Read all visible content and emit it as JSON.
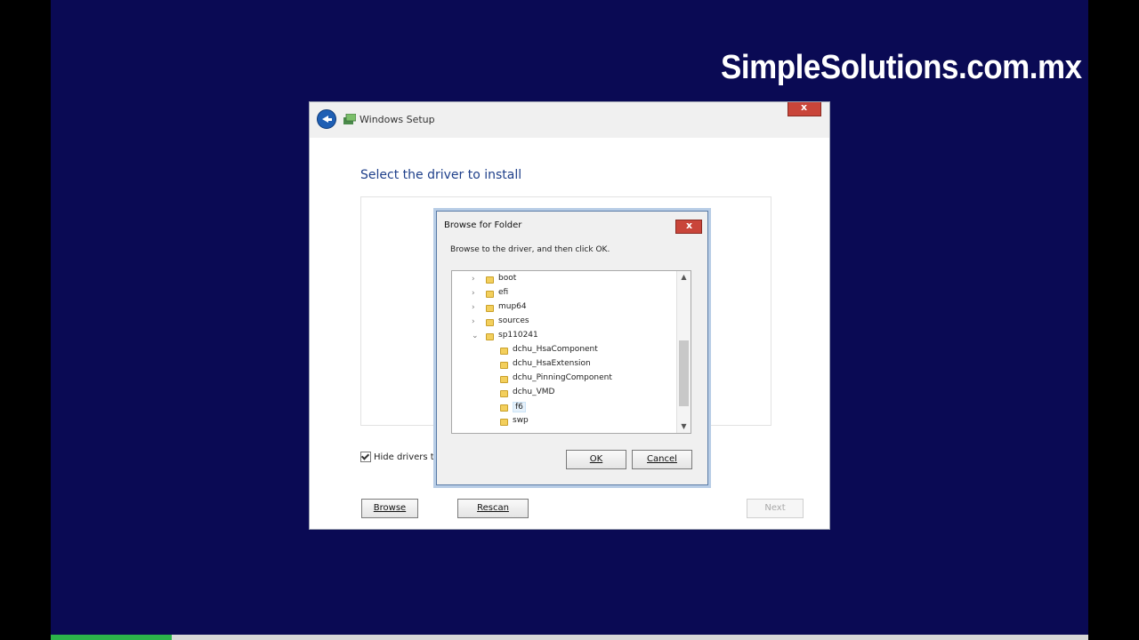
{
  "watermark": "SimpleSolutions.com.mx",
  "setup": {
    "title": "Windows Setup",
    "heading": "Select the driver to install",
    "hide_drivers_label": "Hide drivers th",
    "buttons": {
      "browse": "Browse",
      "rescan": "Rescan",
      "next": "Next"
    }
  },
  "browse_dialog": {
    "title": "Browse for Folder",
    "instruction": "Browse to the driver, and then click OK.",
    "tree": [
      {
        "label": "boot",
        "expander": "›",
        "level": 0
      },
      {
        "label": "efi",
        "expander": "›",
        "level": 0
      },
      {
        "label": "mup64",
        "expander": "›",
        "level": 0
      },
      {
        "label": "sources",
        "expander": "›",
        "level": 0
      },
      {
        "label": "sp110241",
        "expander": "⌄",
        "level": 0
      },
      {
        "label": "dchu_HsaComponent",
        "expander": "",
        "level": 1
      },
      {
        "label": "dchu_HsaExtension",
        "expander": "",
        "level": 1
      },
      {
        "label": "dchu_PinningComponent",
        "expander": "",
        "level": 1
      },
      {
        "label": "dchu_VMD",
        "expander": "",
        "level": 1
      },
      {
        "label": "f6",
        "expander": "",
        "level": 1,
        "selected": true
      },
      {
        "label": "swp",
        "expander": "",
        "level": 1
      }
    ],
    "buttons": {
      "ok": "OK",
      "cancel": "Cancel"
    }
  },
  "icons": {
    "back": "back-arrow-icon",
    "setup": "windows-setup-icon",
    "close": "close-icon",
    "folder": "folder-icon",
    "scroll_up": "scroll-up-icon",
    "scroll_down": "scroll-down-icon"
  },
  "colors": {
    "desktop": "#0a0a54",
    "heading": "#1e3f8a",
    "close": "#c9453a"
  }
}
